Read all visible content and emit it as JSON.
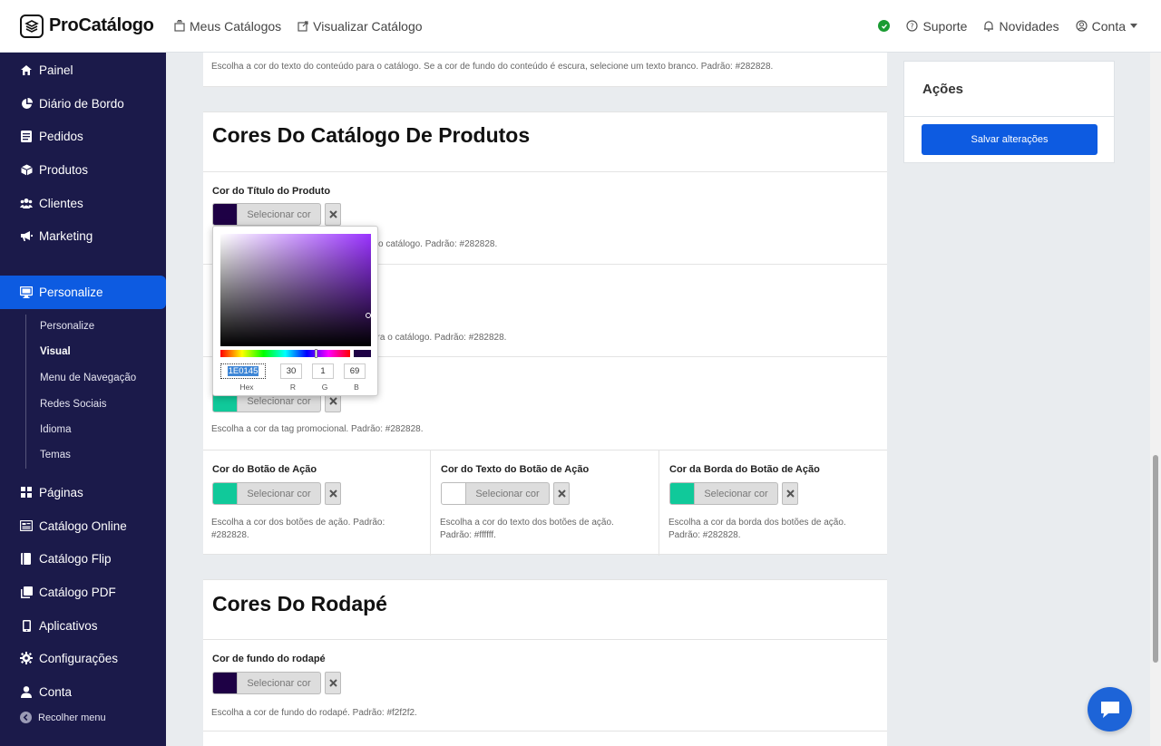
{
  "app": {
    "name": "ProCatálogo"
  },
  "topnav": {
    "my_catalogs": "Meus Catálogos",
    "view_catalog": "Visualizar Catálogo",
    "support": "Suporte",
    "news": "Novidades",
    "account": "Conta"
  },
  "sidebar": {
    "items": [
      {
        "label": "Painel",
        "icon": "dashboard-icon"
      },
      {
        "label": "Diário de Bordo",
        "icon": "pie-chart-icon"
      },
      {
        "label": "Pedidos",
        "icon": "orders-icon"
      },
      {
        "label": "Produtos",
        "icon": "box-icon"
      },
      {
        "label": "Clientes",
        "icon": "users-icon"
      },
      {
        "label": "Marketing",
        "icon": "megaphone-icon"
      },
      {
        "label": "Personalize",
        "icon": "monitor-icon"
      },
      {
        "label": "Páginas",
        "icon": "grid-icon"
      },
      {
        "label": "Catálogo Online",
        "icon": "catalog-icon"
      },
      {
        "label": "Catálogo Flip",
        "icon": "book-icon"
      },
      {
        "label": "Catálogo PDF",
        "icon": "pdf-icon"
      },
      {
        "label": "Aplicativos",
        "icon": "mobile-icon"
      },
      {
        "label": "Configurações",
        "icon": "gear-icon"
      },
      {
        "label": "Conta",
        "icon": "user-icon"
      }
    ],
    "subitems": [
      "Personalize",
      "Visual",
      "Menu de Navegação",
      "Redes Sociais",
      "Idioma",
      "Temas"
    ],
    "collapse": "Recolher menu"
  },
  "content": {
    "top_desc": "Escolha a cor do texto do conteúdo para o catálogo. Se a cor de fundo do conteúdo é escura, selecione um texto branco. Padrão: #282828.",
    "products_title": "Cores Do Catálogo De Produtos",
    "product_title_label": "Cor do Título do Produto",
    "product_title_desc": "o catálogo. Padrão: #282828.",
    "field2_desc": "ara o catálogo. Padrão: #282828.",
    "tag_desc": "Escolha a cor da tag promocional. Padrão: #282828.",
    "action_btn_label": "Cor do Botão de Ação",
    "action_btn_desc": "Escolha a cor dos botões de ação. Padrão: #282828.",
    "action_text_label": "Cor do Texto do Botão de Ação",
    "action_text_desc": "Escolha a cor do texto dos botões de ação. Padrão: #ffffff.",
    "action_border_label": "Cor da Borda do Botão de Ação",
    "action_border_desc": "Escolha a cor da borda dos botões de ação. Padrão: #282828.",
    "footer_title": "Cores Do Rodapé",
    "footer_bg_label": "Cor de fundo do rodapé",
    "footer_bg_desc": "Escolha a cor de fundo do rodapé. Padrão: #f2f2f2.",
    "select_color": "Selecionar cor"
  },
  "swatches": {
    "product_title": "#1e0145",
    "tag": "#10c99a",
    "action_btn": "#10c99a",
    "action_text": "#ffffff",
    "action_border": "#10c99a",
    "footer_bg": "#1e0145"
  },
  "picker": {
    "hex": "1E0145",
    "r": "30",
    "g": "1",
    "b": "69",
    "hex_label": "Hex",
    "r_label": "R",
    "g_label": "G",
    "b_label": "B"
  },
  "actions": {
    "title": "Ações",
    "save": "Salvar alterações"
  }
}
